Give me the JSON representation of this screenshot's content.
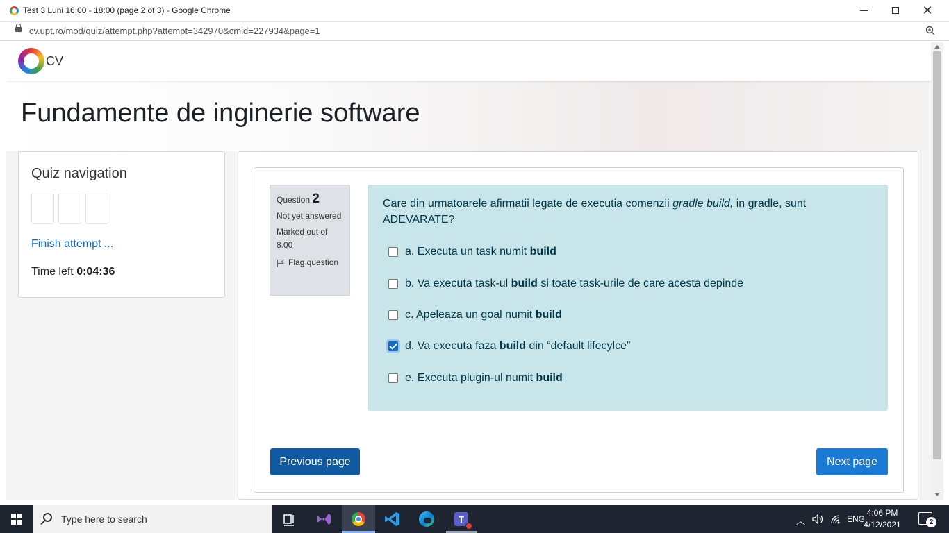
{
  "browser": {
    "window_title": "Test 3 Luni 16:00 - 18:00 (page 2 of 3) - Google Chrome",
    "url": "cv.upt.ro/mod/quiz/attempt.php?attempt=342970&cmid=227934&page=1"
  },
  "site": {
    "logo_text": "CV",
    "course_title": "Fundamente de inginerie software"
  },
  "quiz_nav": {
    "heading": "Quiz navigation",
    "finish_link": "Finish attempt ...",
    "time_label": "Time left",
    "time_value": "0:04:36"
  },
  "question": {
    "label": "Question",
    "number": "2",
    "status": "Not yet answered",
    "marks": "Marked out of 8.00",
    "flag_label": "Flag question",
    "text_before": "Care din urmatoarele afirmatii legate de executia comenzii ",
    "text_italic": "gradle build,",
    "text_after": " in gradle, sunt ADEVARATE?",
    "answers": [
      {
        "prefix": "a. Executa un task numit ",
        "bold": "build",
        "suffix": "",
        "checked": false
      },
      {
        "prefix": "b. Va executa task-ul ",
        "bold": "build",
        "suffix": " si toate task-urile de care acesta depinde",
        "checked": false
      },
      {
        "prefix": "c. Apeleaza un goal numit ",
        "bold": "build",
        "suffix": "",
        "checked": false
      },
      {
        "prefix": "d. Va executa faza ",
        "bold": "build",
        "suffix": " din “default lifecylce”",
        "checked": true
      },
      {
        "prefix": "e. Executa plugin-ul numit ",
        "bold": "build",
        "suffix": "",
        "checked": false
      }
    ]
  },
  "buttons": {
    "previous": "Previous page",
    "next": "Next page"
  },
  "taskbar": {
    "search_placeholder": "Type here to search",
    "language": "ENG",
    "time": "4:06 PM",
    "date": "4/12/2021",
    "notification_count": "2"
  },
  "colors": {
    "primary": "#0f6cbf",
    "question_bg": "#c8e6e9",
    "question_text": "#00384a"
  }
}
